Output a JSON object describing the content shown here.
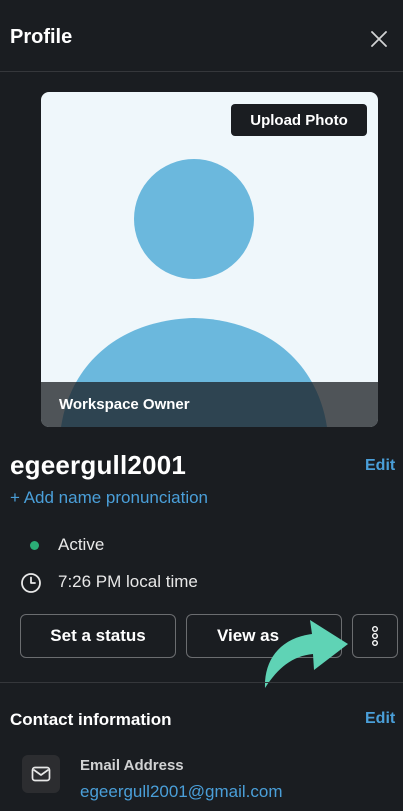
{
  "header": {
    "title": "Profile",
    "close_icon": "close-icon"
  },
  "photo": {
    "upload_label": "Upload Photo",
    "role": "Workspace Owner",
    "avatar_icon": "default-avatar-icon",
    "background_color": "#eff7fb",
    "avatar_color": "#6bb8dd"
  },
  "profile": {
    "display_name": "egeergull2001",
    "edit_label": "Edit",
    "pronunciation_label": "+ Add name pronunciation",
    "status": "Active",
    "status_color": "#2bac76",
    "local_time": "7:26 PM local time",
    "clock_icon": "clock-icon"
  },
  "actions": {
    "set_status_label": "Set a status",
    "view_as_label": "View as",
    "more_icon": "more-vertical-icon"
  },
  "overlay": {
    "arrow_icon": "curved-arrow-icon",
    "arrow_color": "#5fd3b5"
  },
  "contact": {
    "title": "Contact information",
    "edit_label": "Edit",
    "email_label": "Email Address",
    "email_value": "egeergull2001@gmail.com",
    "email_icon": "envelope-icon"
  },
  "colors": {
    "background": "#1a1d21",
    "link": "#4a9fd9",
    "border": "#6b6d70"
  }
}
